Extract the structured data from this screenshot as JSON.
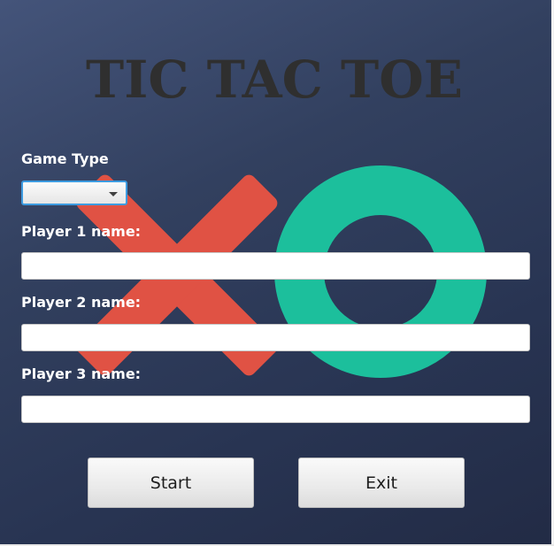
{
  "app": {
    "title": "TIC TAC TOE"
  },
  "form": {
    "game_type_label": "Game Type",
    "game_type_value": "",
    "player1_label": "Player 1 name:",
    "player1_value": "",
    "player2_label": "Player 2 name:",
    "player2_value": "",
    "player3_label": "Player 3 name:",
    "player3_value": ""
  },
  "buttons": {
    "start_label": "Start",
    "exit_label": "Exit"
  },
  "background_art": {
    "icons": [
      "x-mark-icon",
      "o-ring-icon"
    ],
    "colors": {
      "x_mark": "#e05244",
      "o_ring": "#1cbf9c",
      "background": "#32405f",
      "focus_border": "#3d9be0"
    }
  }
}
